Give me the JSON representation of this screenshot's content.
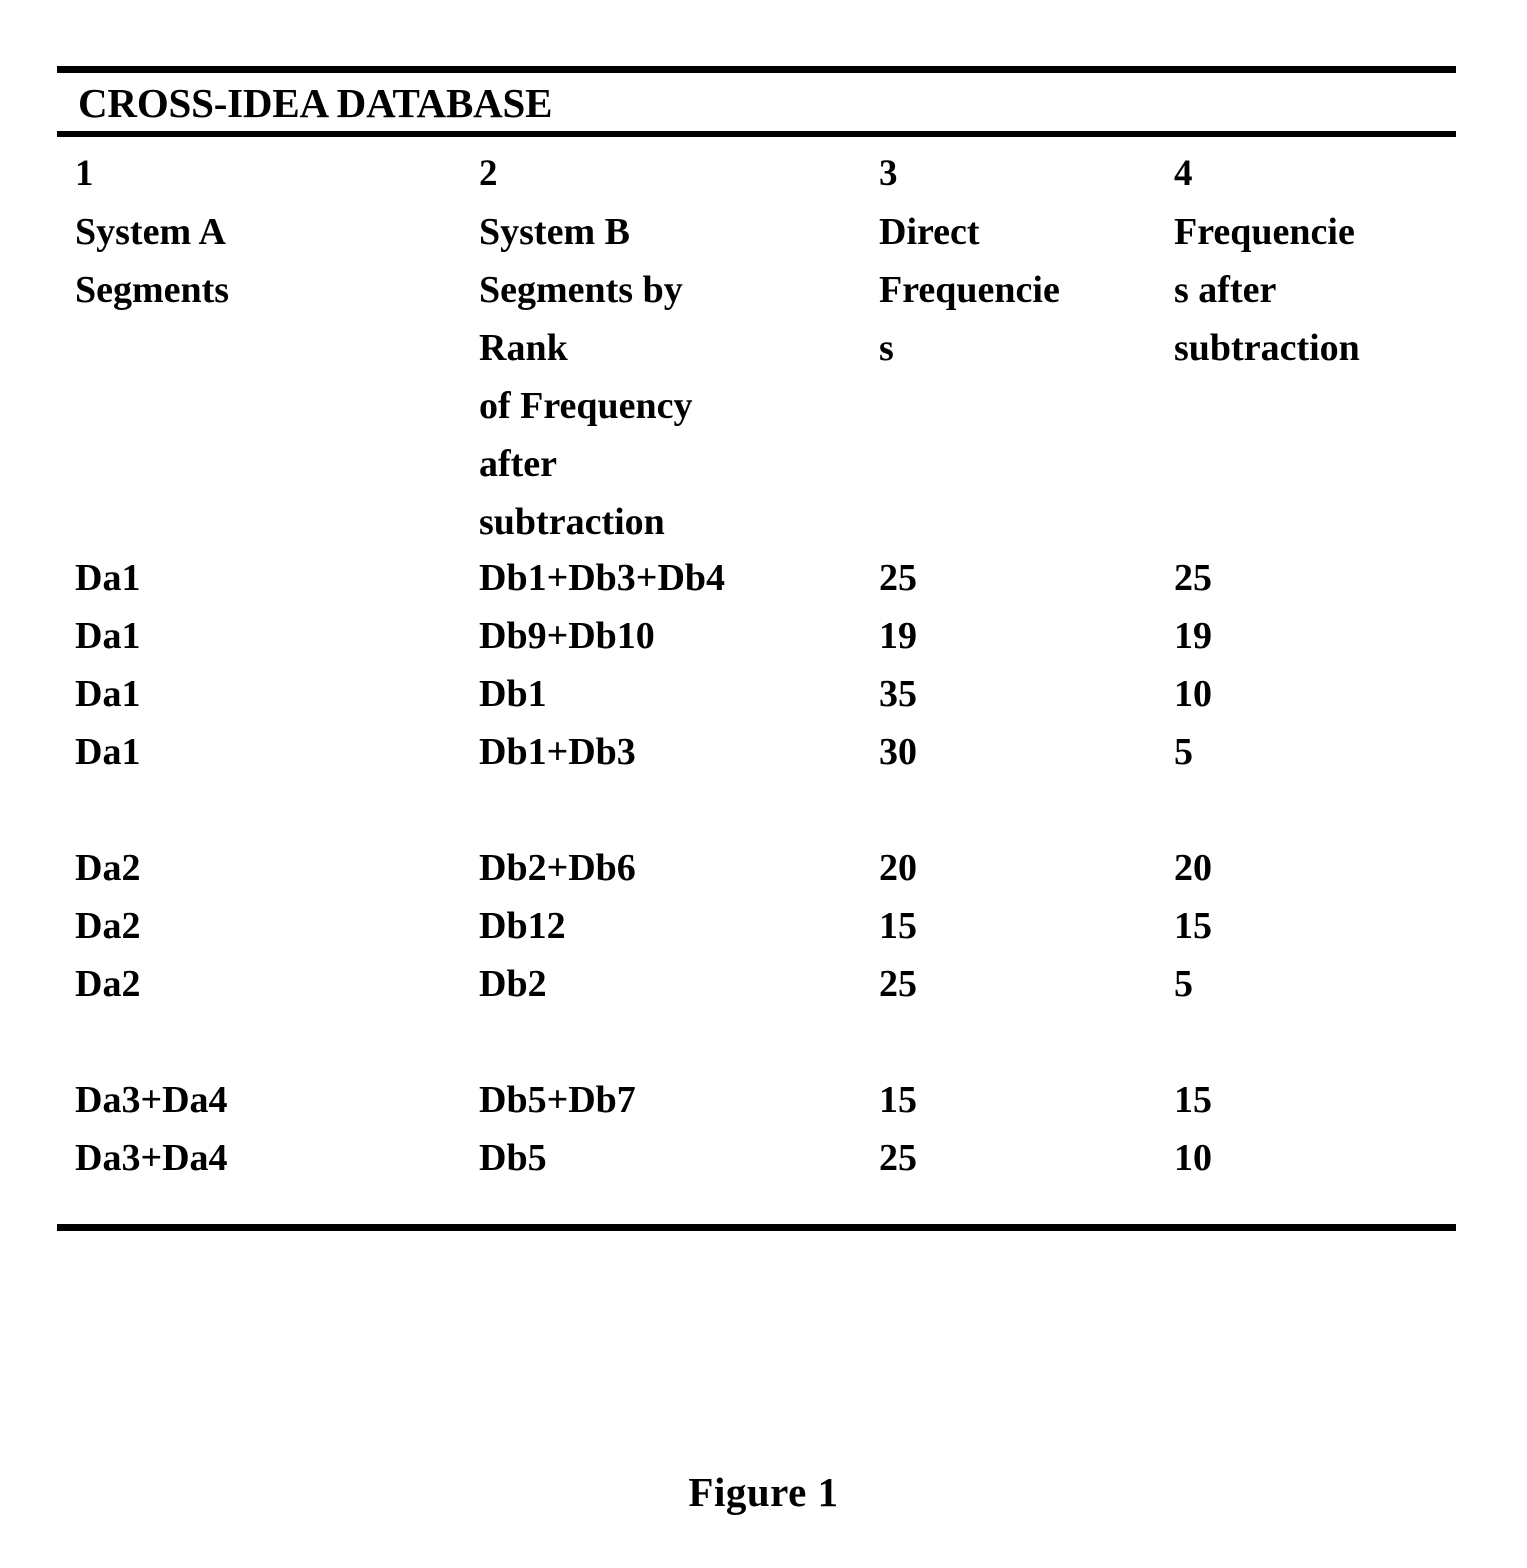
{
  "table": {
    "title": "CROSS-IDEA DATABASE",
    "columns": [
      {
        "number": "1",
        "header_lines": [
          "System A",
          "Segments"
        ]
      },
      {
        "number": "2",
        "header_lines": [
          "System B",
          "Segments by",
          "Rank",
          "of Frequency",
          "after",
          "subtraction"
        ]
      },
      {
        "number": "3",
        "header_lines": [
          "Direct",
          "Frequencie",
          "s"
        ]
      },
      {
        "number": "4",
        "header_lines": [
          "Frequencie",
          "s after",
          "subtraction"
        ]
      }
    ],
    "rows": [
      {
        "spacer": false,
        "c1": "Da1",
        "c2": "Db1+Db3+Db4",
        "c3": "25",
        "c4": "25"
      },
      {
        "spacer": false,
        "c1": "Da1",
        "c2": "Db9+Db10",
        "c3": "19",
        "c4": "19"
      },
      {
        "spacer": false,
        "c1": "Da1",
        "c2": "Db1",
        "c3": "35",
        "c4": "10"
      },
      {
        "spacer": false,
        "c1": "Da1",
        "c2": "Db1+Db3",
        "c3": "30",
        "c4": "5"
      },
      {
        "spacer": true,
        "c1": "",
        "c2": "",
        "c3": "",
        "c4": ""
      },
      {
        "spacer": false,
        "c1": "Da2",
        "c2": "Db2+Db6",
        "c3": "20",
        "c4": "20"
      },
      {
        "spacer": false,
        "c1": "Da2",
        "c2": "Db12",
        "c3": "15",
        "c4": "15"
      },
      {
        "spacer": false,
        "c1": "Da2",
        "c2": "Db2",
        "c3": "25",
        "c4": "5"
      },
      {
        "spacer": true,
        "c1": "",
        "c2": "",
        "c3": "",
        "c4": ""
      },
      {
        "spacer": false,
        "c1": "Da3+Da4",
        "c2": "Db5+Db7",
        "c3": "15",
        "c4": "15"
      },
      {
        "spacer": false,
        "c1": "Da3+Da4",
        "c2": "Db5",
        "c3": "25",
        "c4": "10"
      }
    ]
  },
  "figure": {
    "caption": "Figure 1"
  }
}
